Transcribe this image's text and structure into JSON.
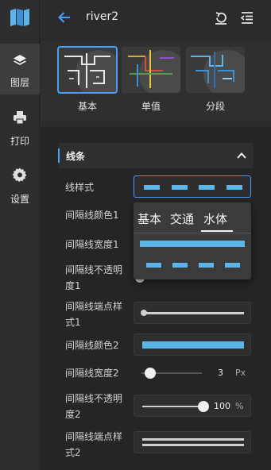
{
  "header": {
    "title": "river2"
  },
  "sidebar": {
    "items": [
      {
        "label": "图层",
        "icon": "layers-icon",
        "active": true
      },
      {
        "label": "打印",
        "icon": "printer-icon",
        "active": false
      },
      {
        "label": "设置",
        "icon": "gear-icon",
        "active": false
      }
    ]
  },
  "themes": [
    {
      "label": "基本",
      "selected": true
    },
    {
      "label": "单值",
      "selected": false
    },
    {
      "label": "分段",
      "selected": false
    }
  ],
  "section": {
    "title": "线条"
  },
  "rows": [
    {
      "label": "线样式"
    },
    {
      "label": "间隔线颜色1"
    },
    {
      "label": "间隔线宽度1"
    },
    {
      "label": "间隔线不透明度1"
    },
    {
      "label": "间隔线端点样式1"
    },
    {
      "label": "间隔线颜色2"
    },
    {
      "label": "间隔线宽度2",
      "value": "3",
      "unit": "Px"
    },
    {
      "label": "间隔线不透明度2",
      "value": "100",
      "unit": "%"
    },
    {
      "label": "间隔线端点样式2"
    }
  ],
  "dropdown": {
    "tabs": [
      "基本",
      "交通",
      "水体"
    ],
    "active_tab": "水体"
  },
  "colors": {
    "accent": "#4a9df8",
    "line": "#5ab6ea"
  }
}
